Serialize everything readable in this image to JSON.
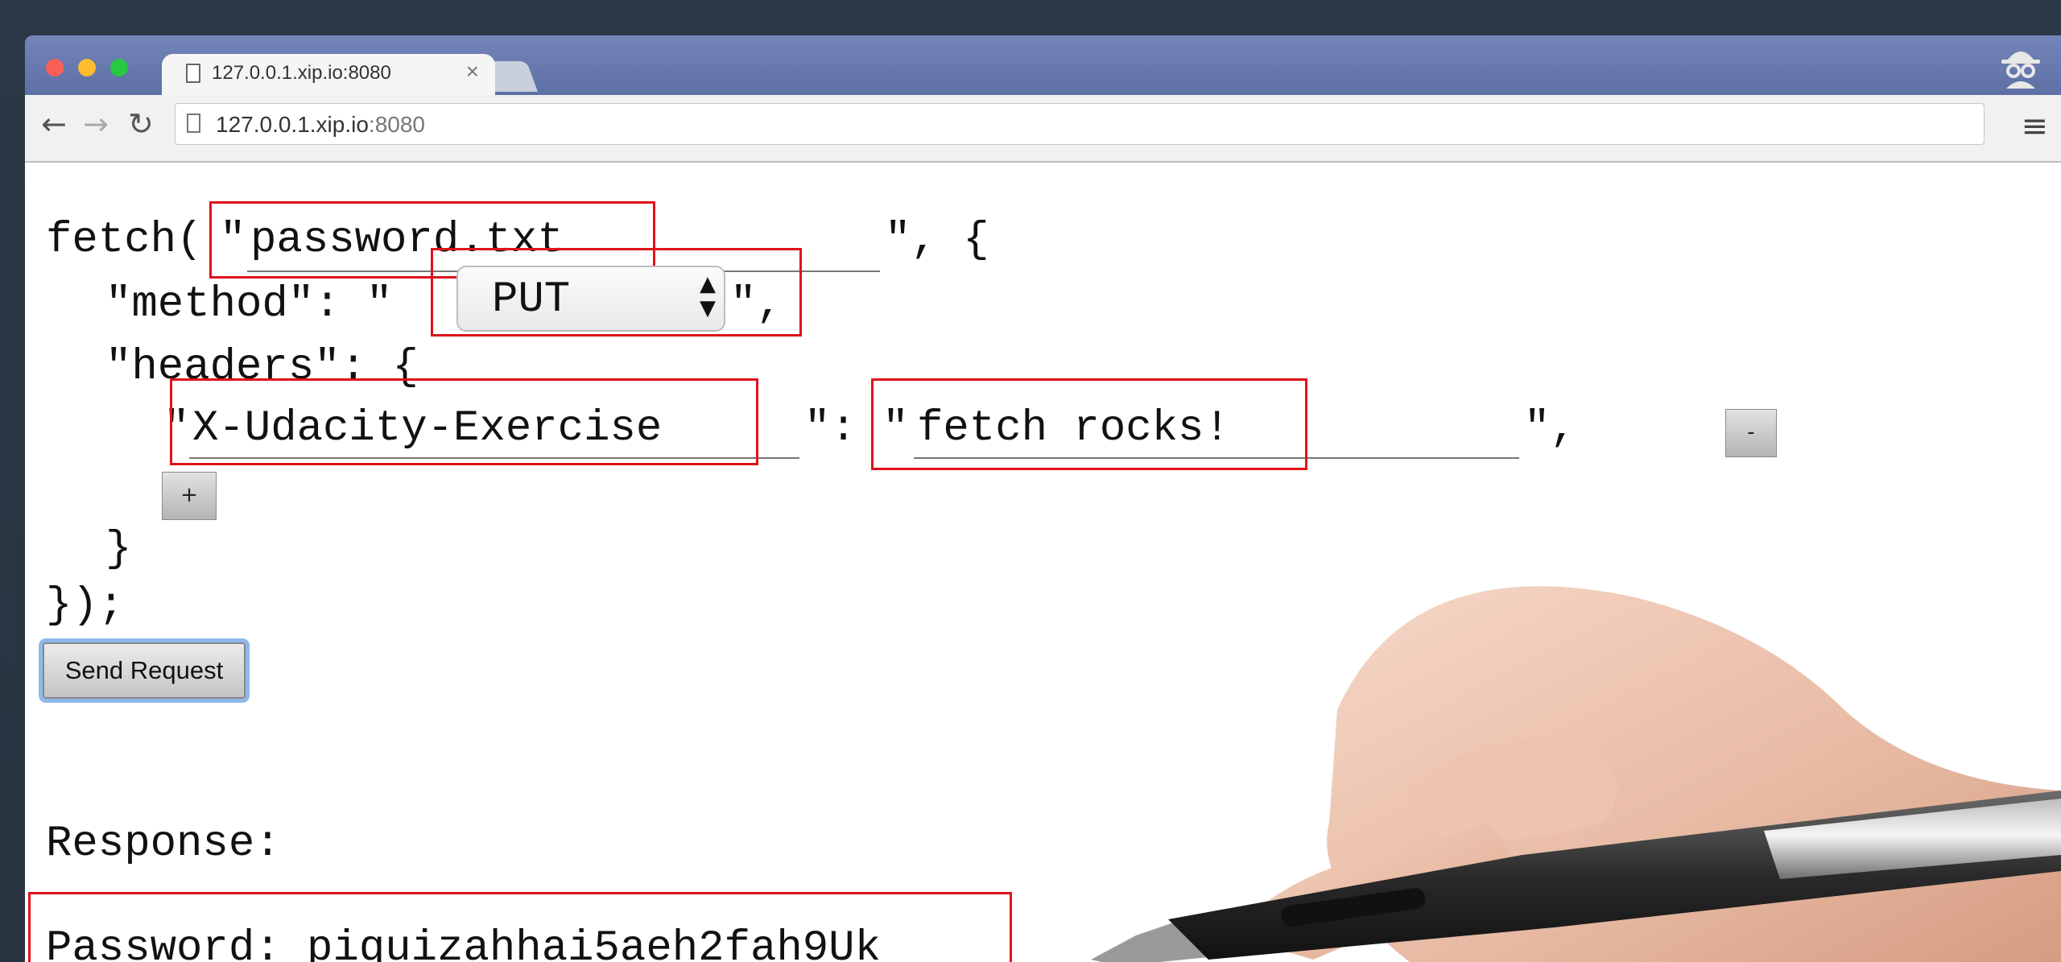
{
  "browser": {
    "tab_title": "127.0.0.1.xip.io:8080",
    "tab_close": "×",
    "url_host": "127.0.0.1.xip.io",
    "url_port": ":8080",
    "icons": [
      "back-icon",
      "forward-icon",
      "reload-icon",
      "page-icon",
      "menu-icon",
      "incognito-icon"
    ]
  },
  "code": {
    "fetch_open": "fetch(",
    "quote": "\"",
    "after_url": "\", {",
    "method_key": "\"method\": \"",
    "after_method": "\",",
    "headers_key": "\"headers\": {",
    "colon_quote": "\": \"",
    "after_header_value": "\",",
    "close_headers": "}",
    "close_fetch": "});"
  },
  "form": {
    "url_value": "password.txt",
    "method_value": "PUT",
    "header_name_value": "X-Udacity-Exercise",
    "header_value_value": "fetch rocks!",
    "remove_header_label": "-",
    "add_header_label": "+",
    "send_label": "Send Request"
  },
  "response": {
    "label": "Response:",
    "text": "Password: piquizahhai5aeh2fah9Uk"
  },
  "colors": {
    "highlight": "#e0121b",
    "focus_ring": "#8fb9ec",
    "tabbar": "#6c7eb3"
  }
}
